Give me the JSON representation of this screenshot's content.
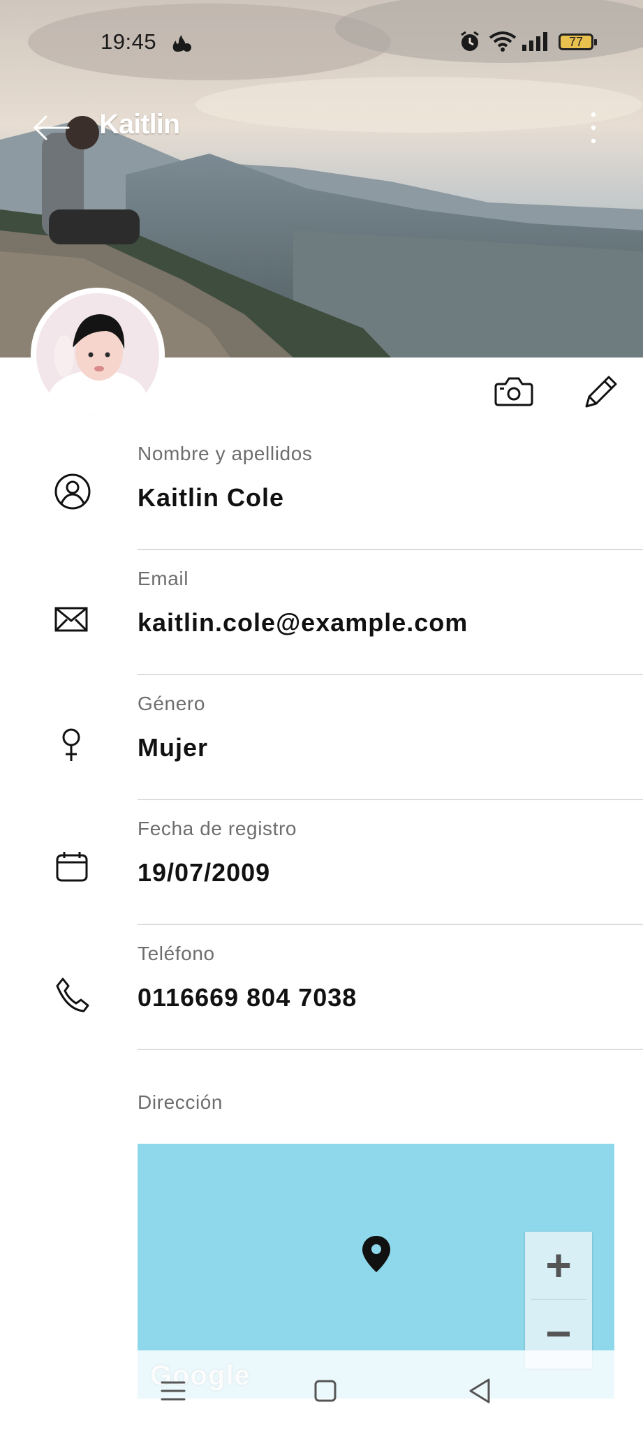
{
  "status_bar": {
    "time": "19:45",
    "battery": "77",
    "icons": [
      "fire-notification-icon",
      "alarm-icon",
      "wifi-icon",
      "signal-icon",
      "battery-icon"
    ]
  },
  "header": {
    "title": "Kaitlin",
    "back_icon": "arrow-left-icon",
    "more_icon": "more-vertical-icon"
  },
  "actions": {
    "camera_icon": "camera-icon",
    "edit_icon": "pencil-icon"
  },
  "fields": [
    {
      "label": "Nombre y apellidos",
      "value": "Kaitlin Cole",
      "icon": "user-circle-icon"
    },
    {
      "label": "Email",
      "value": "kaitlin.cole@example.com",
      "icon": "mail-icon"
    },
    {
      "label": "Género",
      "value": "Mujer",
      "icon": "female-icon"
    },
    {
      "label": "Fecha de registro",
      "value": "19/07/2009",
      "icon": "calendar-icon"
    },
    {
      "label": "Teléfono",
      "value": "0116669 804 7038",
      "icon": "phone-icon"
    }
  ],
  "address": {
    "label": "Dirección",
    "map": {
      "zoom_in": "+",
      "zoom_out": "−",
      "logo": "Google",
      "pin_icon": "map-pin-icon",
      "water_color": "#8fd8ec"
    }
  },
  "nav_bar": {
    "icons": [
      "menu-icon",
      "home-square-icon",
      "back-triangle-icon"
    ]
  }
}
